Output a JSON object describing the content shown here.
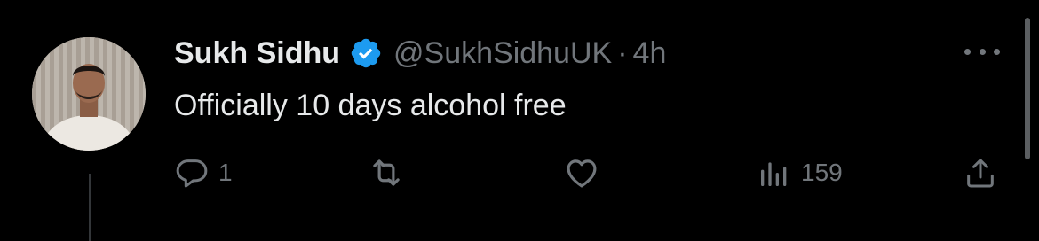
{
  "tweet": {
    "display_name": "Sukh Sidhu",
    "handle": "@SukhSidhuUK",
    "separator": "·",
    "time": "4h",
    "text": "Officially 10 days alcohol free",
    "verified_icon": "verified-badge-icon",
    "verified_color": "#1d9bf0"
  },
  "actions": {
    "reply": {
      "icon": "reply-icon",
      "count": "1"
    },
    "retweet": {
      "icon": "retweet-icon",
      "count": ""
    },
    "like": {
      "icon": "heart-icon",
      "count": ""
    },
    "views": {
      "icon": "views-chart-icon",
      "count": "159"
    },
    "share": {
      "icon": "share-icon",
      "count": ""
    }
  },
  "colors": {
    "background": "#000000",
    "primary_text": "#e7e9ea",
    "secondary_text": "#71767b",
    "thread_line": "#333639"
  }
}
